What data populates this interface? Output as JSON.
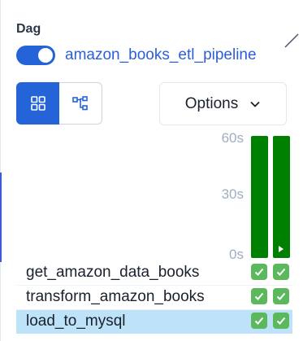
{
  "dag": {
    "label": "Dag",
    "name": "amazon_books_etl_pipeline",
    "enabled": true
  },
  "toolbar": {
    "view_grid_icon": "grid-icon",
    "view_graph_icon": "graph-icon",
    "options_label": "Options",
    "options_icon": "chevron-down-icon"
  },
  "chart": {
    "axis_ticks": [
      "60s",
      "30s",
      "0s"
    ],
    "run_bar_color": "#008000"
  },
  "tasks": [
    {
      "name": "get_amazon_data_books",
      "status": [
        "success",
        "success"
      ],
      "selected": false
    },
    {
      "name": "transform_amazon_books",
      "status": [
        "success",
        "success"
      ],
      "selected": false
    },
    {
      "name": "load_to_mysql",
      "status": [
        "success",
        "success"
      ],
      "selected": true
    }
  ],
  "colors": {
    "accent": "#2563d8",
    "success": "#5cb85c",
    "selected_row": "#bee3f8"
  }
}
